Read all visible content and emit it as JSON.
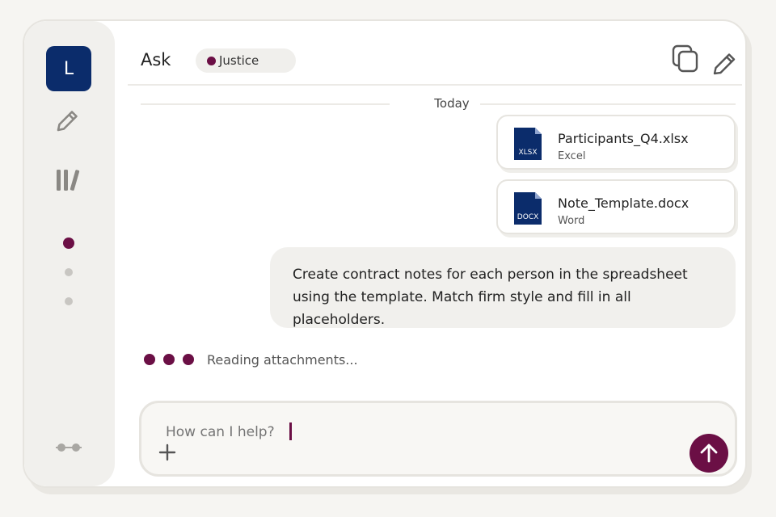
{
  "sidebar": {
    "avatar_initial": "L",
    "icons": [
      "pencil-icon",
      "library-icon"
    ],
    "nav_dots": 3
  },
  "header": {
    "title": "Ask",
    "workspace": "Justice",
    "actions": [
      "copy-icon",
      "edit-icon"
    ]
  },
  "conversation": {
    "date_divider": "Today",
    "attachments": [
      {
        "name": "Participants_Q4.xlsx",
        "type": "Excel",
        "badge": "XLSX"
      },
      {
        "name": "Note_Template.docx",
        "type": "Word",
        "badge": "DOCX"
      }
    ],
    "user_message": "Create contract notes for each person in the spreadsheet using the template. Match firm style and fill in all placeholders.",
    "status": "Reading attachments..."
  },
  "composer": {
    "placeholder": "How can I help?",
    "value": ""
  },
  "colors": {
    "accent": "#6b0f45",
    "avatar": "#0b2c6b",
    "file_icon": "#0b2c6b"
  }
}
